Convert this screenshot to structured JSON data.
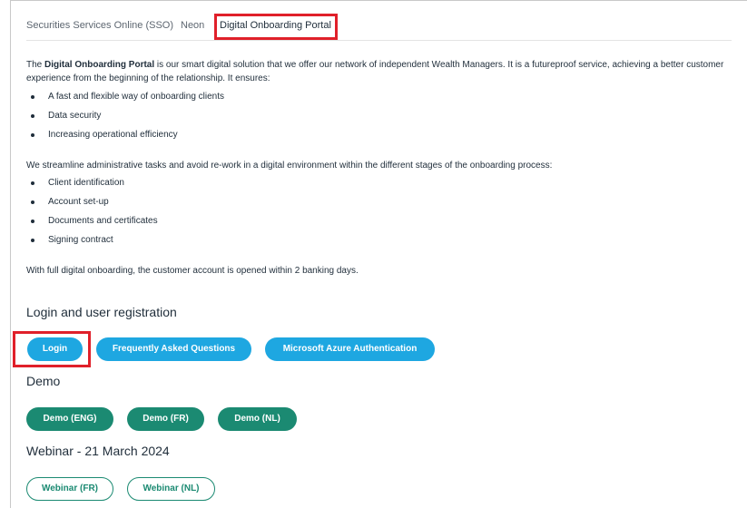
{
  "tabs": [
    "Securities Services Online (SSO)",
    "Neon",
    "Digital Onboarding Portal"
  ],
  "intro": {
    "prefix": "The ",
    "bold": "Digital Onboarding Portal",
    "rest": " is our smart digital solution that we offer our network of independent Wealth Managers. It is a futureproof service, achieving a better customer experience from the beginning of the relationship. It ensures:",
    "bullets": [
      "A fast and flexible way of onboarding clients",
      "Data security",
      "Increasing operational efficiency"
    ]
  },
  "streamline": {
    "text": "We streamline administrative tasks and avoid re-work in a digital environment within the different stages of the onboarding process:",
    "bullets": [
      "Client identification",
      "Account set-up",
      "Documents and certificates",
      "Signing contract"
    ]
  },
  "closing": "With full digital onboarding, the customer account is opened within 2 banking days.",
  "login_section": {
    "heading": "Login and user registration",
    "buttons": [
      "Login",
      "Frequently Asked Questions",
      "Microsoft Azure Authentication"
    ]
  },
  "demo_section": {
    "heading": "Demo",
    "buttons": [
      "Demo (ENG)",
      "Demo (FR)",
      "Demo (NL)"
    ]
  },
  "webinar_section": {
    "heading": "Webinar - 21 March 2024",
    "buttons": [
      "Webinar (FR)",
      "Webinar (NL)"
    ]
  },
  "colors": {
    "highlight": "#e0202a",
    "blue_button": "#1ea7e1",
    "green_button": "#1b8a72"
  }
}
